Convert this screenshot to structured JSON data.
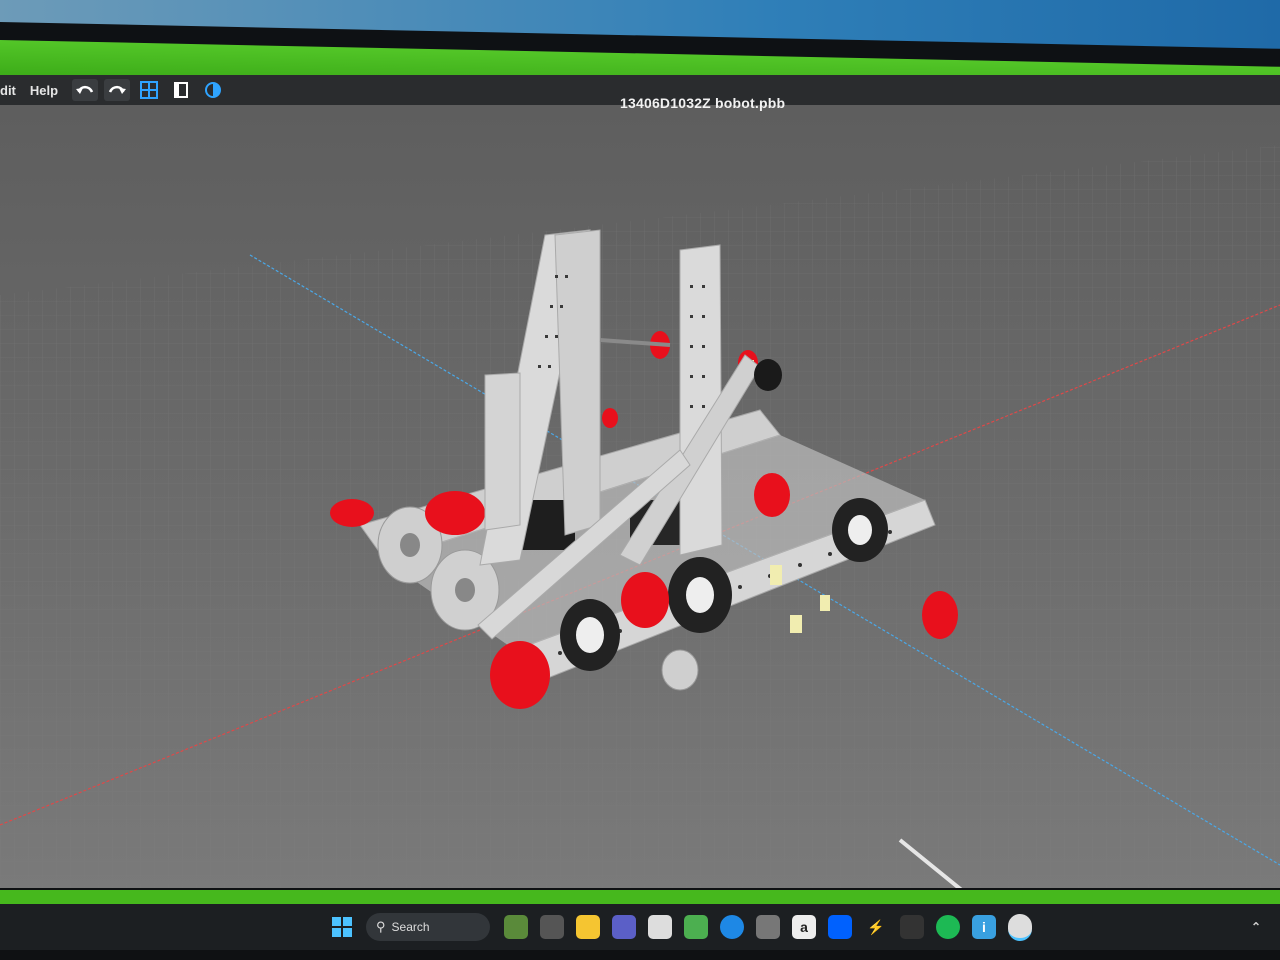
{
  "menu": {
    "edit_label": "dit",
    "help_label": "Help"
  },
  "document": {
    "title": "13406D1032Z bobot.pbb"
  },
  "taskbar": {
    "search_label": "Search"
  },
  "colors": {
    "accent_green": "#46b81d",
    "part_red": "#e8101c",
    "part_gray": "#d9d9d9",
    "viewport_gray": "#6c6c6c"
  }
}
